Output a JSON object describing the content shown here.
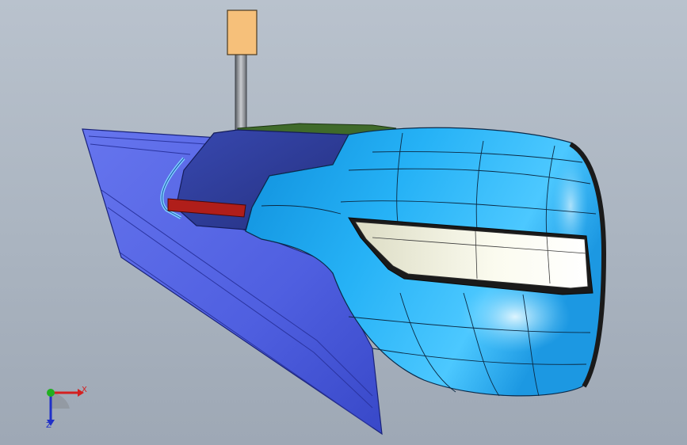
{
  "viewport": {
    "background_top": "#b9c2cd",
    "background_bottom": "#9ea8b5",
    "model": {
      "flange_color": "#4f5fe0",
      "shell_color": "#1ea6ec",
      "recess_color": "#2c3c9c",
      "lamp_color": "#f2f3e6",
      "seal_color": "#3f6a2a",
      "red_strip_color": "#b01e1a",
      "tag_color": "#f6c07a"
    }
  },
  "triad": {
    "x_label": "X",
    "z_label": "Z",
    "x_color": "#d42020",
    "y_color": "#20b020",
    "z_color": "#2030c8"
  }
}
